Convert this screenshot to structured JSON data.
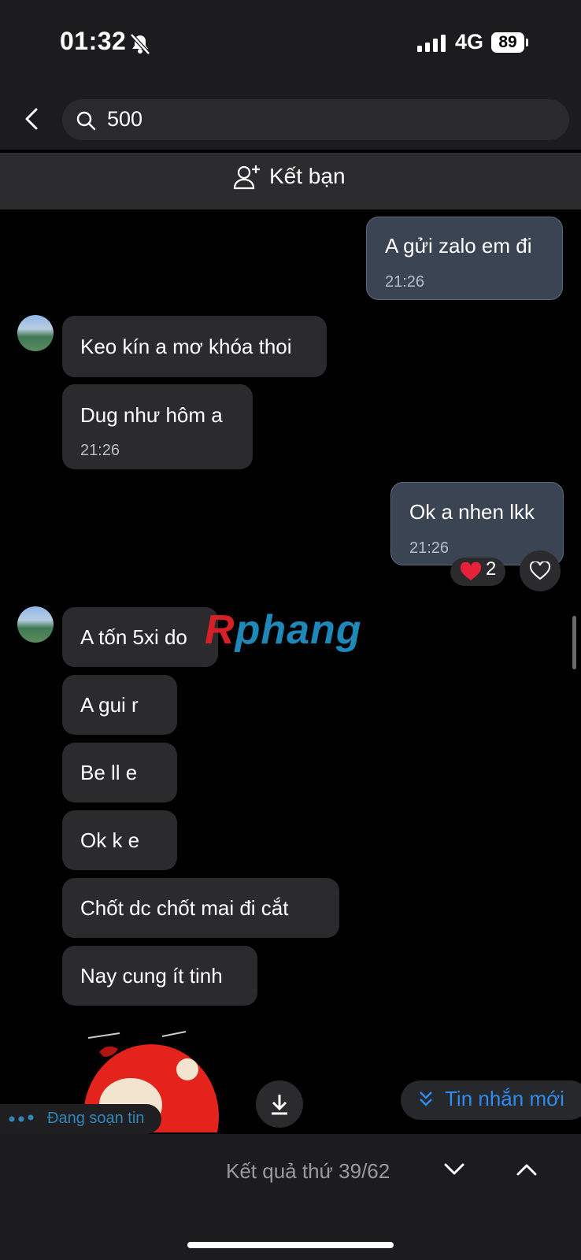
{
  "status_bar": {
    "time": "01:32",
    "network": "4G",
    "battery": "89"
  },
  "search": {
    "query": "500"
  },
  "friend_bar": {
    "label": "Kết bạn"
  },
  "messages": [
    {
      "text": "A gửi zalo em đi",
      "time": "21:26"
    },
    {
      "text": "Keo kín a mơ khóa thoi"
    },
    {
      "text": "Dug như hôm a",
      "time": "21:26"
    },
    {
      "text": "Ok a nhen lkk",
      "time": "21:26",
      "reaction_count": "2"
    },
    {
      "text": "A tốn 5xi do"
    },
    {
      "text": "A gui r"
    },
    {
      "text": "Be ll e"
    },
    {
      "text": "Ok k e"
    },
    {
      "text": "Chốt dc chốt mai đi cắt"
    },
    {
      "text": "Nay cung ít tinh"
    }
  ],
  "watermark": {
    "first": "R",
    "rest": "phang"
  },
  "new_messages": {
    "label": "Tin nhắn mới"
  },
  "typing": {
    "label": "Đang soạn tin"
  },
  "bottom": {
    "result": "Kết quả thứ 39/62"
  },
  "colors": {
    "accent": "#2f8cf0",
    "outgoing_bubble": "#3a4453",
    "incoming_bubble": "#2b2b2e",
    "reaction_heart": "#e8213b"
  },
  "icons": [
    "bell-slash-icon",
    "signal-icon",
    "back-chevron-icon",
    "search-icon",
    "add-friend-icon",
    "heart-icon",
    "heart-outline-icon",
    "download-icon",
    "double-chevron-down-icon",
    "chevron-down-icon",
    "chevron-up-icon"
  ]
}
